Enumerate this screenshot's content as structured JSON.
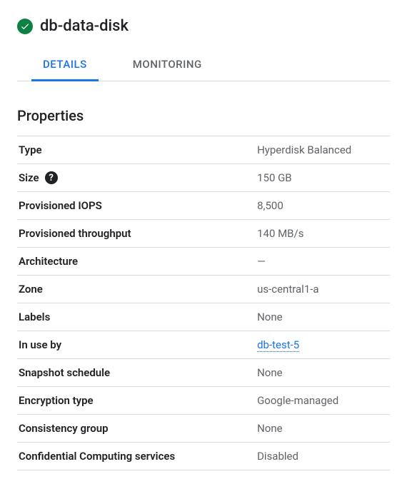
{
  "header": {
    "title": "db-data-disk"
  },
  "tabs": {
    "details": "DETAILS",
    "monitoring": "MONITORING"
  },
  "section_title": "Properties",
  "properties": [
    {
      "label": "Type",
      "value": "Hyperdisk Balanced",
      "help": false,
      "link": false
    },
    {
      "label": "Size",
      "value": "150 GB",
      "help": true,
      "link": false
    },
    {
      "label": "Provisioned IOPS",
      "value": "8,500",
      "help": false,
      "link": false
    },
    {
      "label": "Provisioned throughput",
      "value": "140 MB/s",
      "help": false,
      "link": false
    },
    {
      "label": "Architecture",
      "value": "—",
      "help": false,
      "link": false
    },
    {
      "label": "Zone",
      "value": "us-central1-a",
      "help": false,
      "link": false
    },
    {
      "label": "Labels",
      "value": "None",
      "help": false,
      "link": false
    },
    {
      "label": "In use by",
      "value": "db-test-5",
      "help": false,
      "link": true
    },
    {
      "label": "Snapshot schedule",
      "value": "None",
      "help": false,
      "link": false
    },
    {
      "label": "Encryption type",
      "value": "Google-managed",
      "help": false,
      "link": false
    },
    {
      "label": "Consistency group",
      "value": "None",
      "help": false,
      "link": false
    },
    {
      "label": "Confidential Computing services",
      "value": "Disabled",
      "help": false,
      "link": false
    }
  ]
}
